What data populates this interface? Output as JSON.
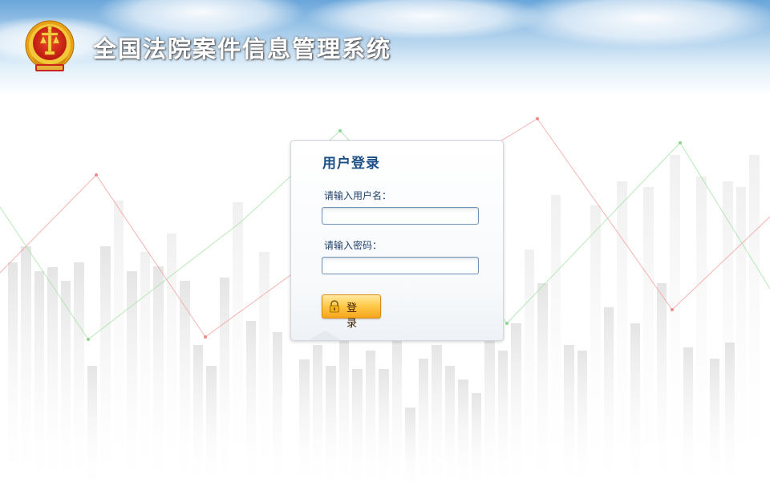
{
  "header": {
    "app_title": "全国法院案件信息管理系统"
  },
  "login": {
    "title": "用户登录",
    "username_label": "请输入用户名：",
    "username_value": "",
    "password_label": "请输入密码：",
    "password_value": "",
    "submit_label": "登 录"
  },
  "theme": {
    "title_color": "#1d4f87",
    "label_color": "#1e4068",
    "button_color": "#ffcb4d",
    "header_sky": "#6aa6da"
  },
  "icons": {
    "emblem": "court-emblem-icon",
    "lock": "lock-icon"
  }
}
